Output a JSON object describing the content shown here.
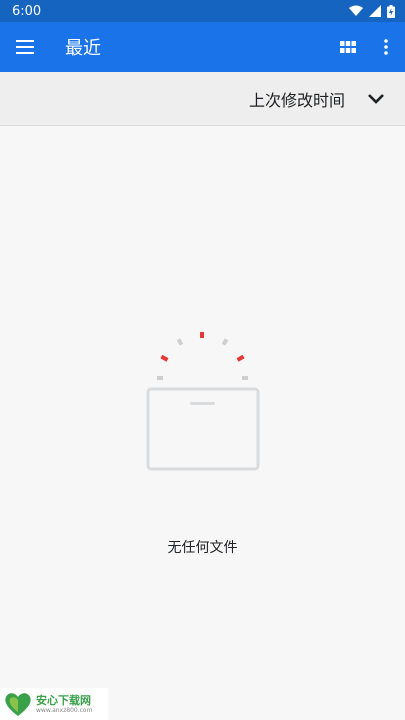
{
  "status_bar": {
    "time": "6:00"
  },
  "app_bar": {
    "title": "最近",
    "menu_icon": "hamburger-menu-icon",
    "grid_icon": "grid-view-icon",
    "more_icon": "more-vertical-icon"
  },
  "sort_bar": {
    "label": "上次修改时间",
    "icon": "chevron-down-icon"
  },
  "empty_state": {
    "message": "无任何文件"
  },
  "watermark": {
    "brand": "安心下载网",
    "url": "www.anxz800.com"
  },
  "colors": {
    "status_bar": "#1565c0",
    "app_bar": "#1a73e8",
    "accent_red": "#e53935"
  }
}
